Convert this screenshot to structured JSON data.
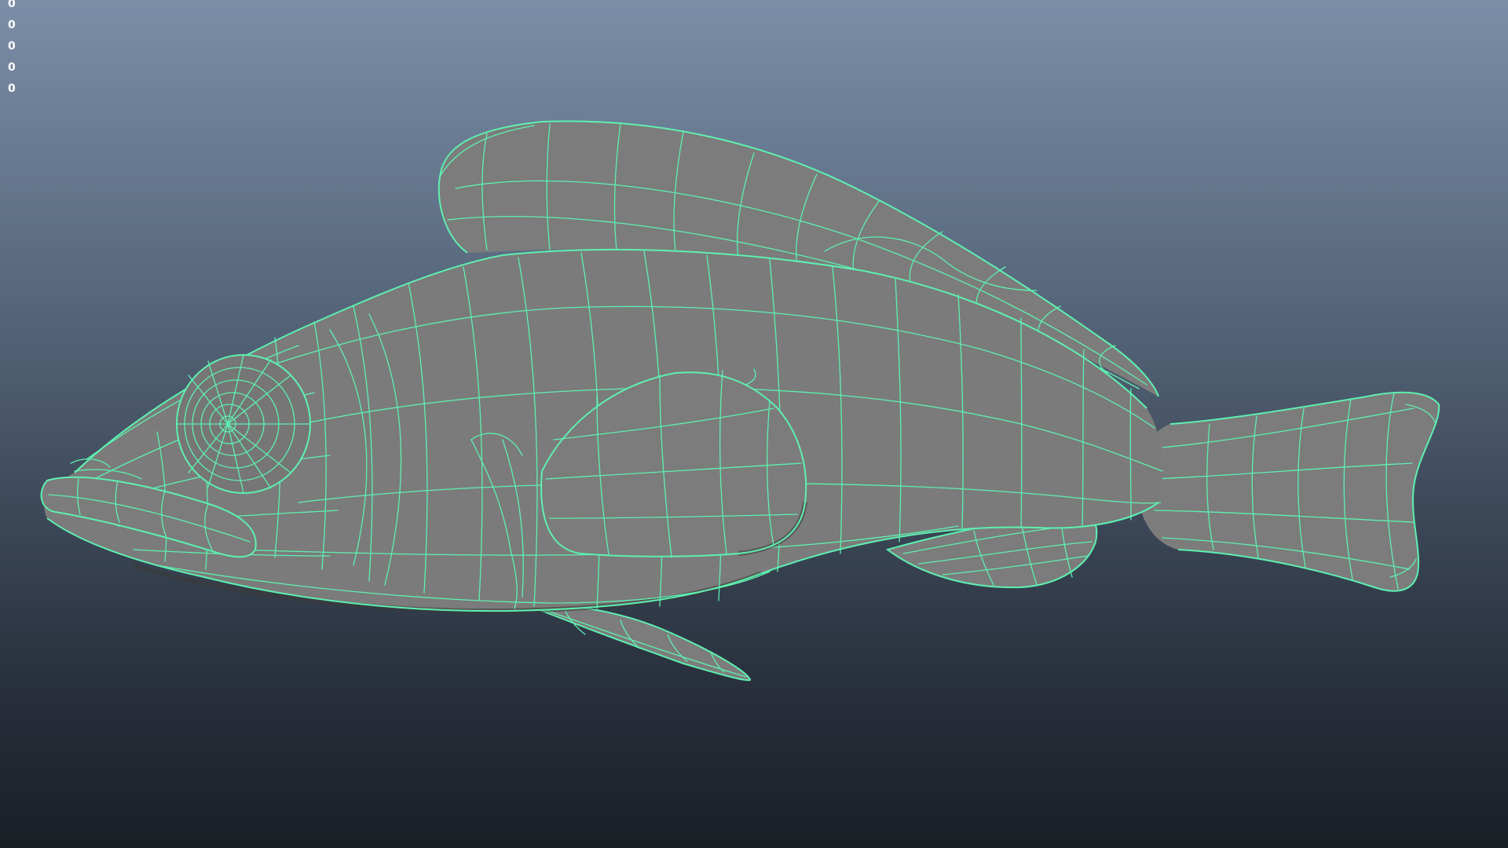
{
  "viewport": {
    "background_top": "#7b8ea7",
    "background_bottom": "#1a1e25",
    "wire_color": "#5ef0b0",
    "mesh_color": "#7b7b7b"
  },
  "hud": {
    "counters": [
      "0",
      "0",
      "0",
      "0",
      "0"
    ]
  },
  "model": {
    "icon": "fish-mesh-icon"
  }
}
